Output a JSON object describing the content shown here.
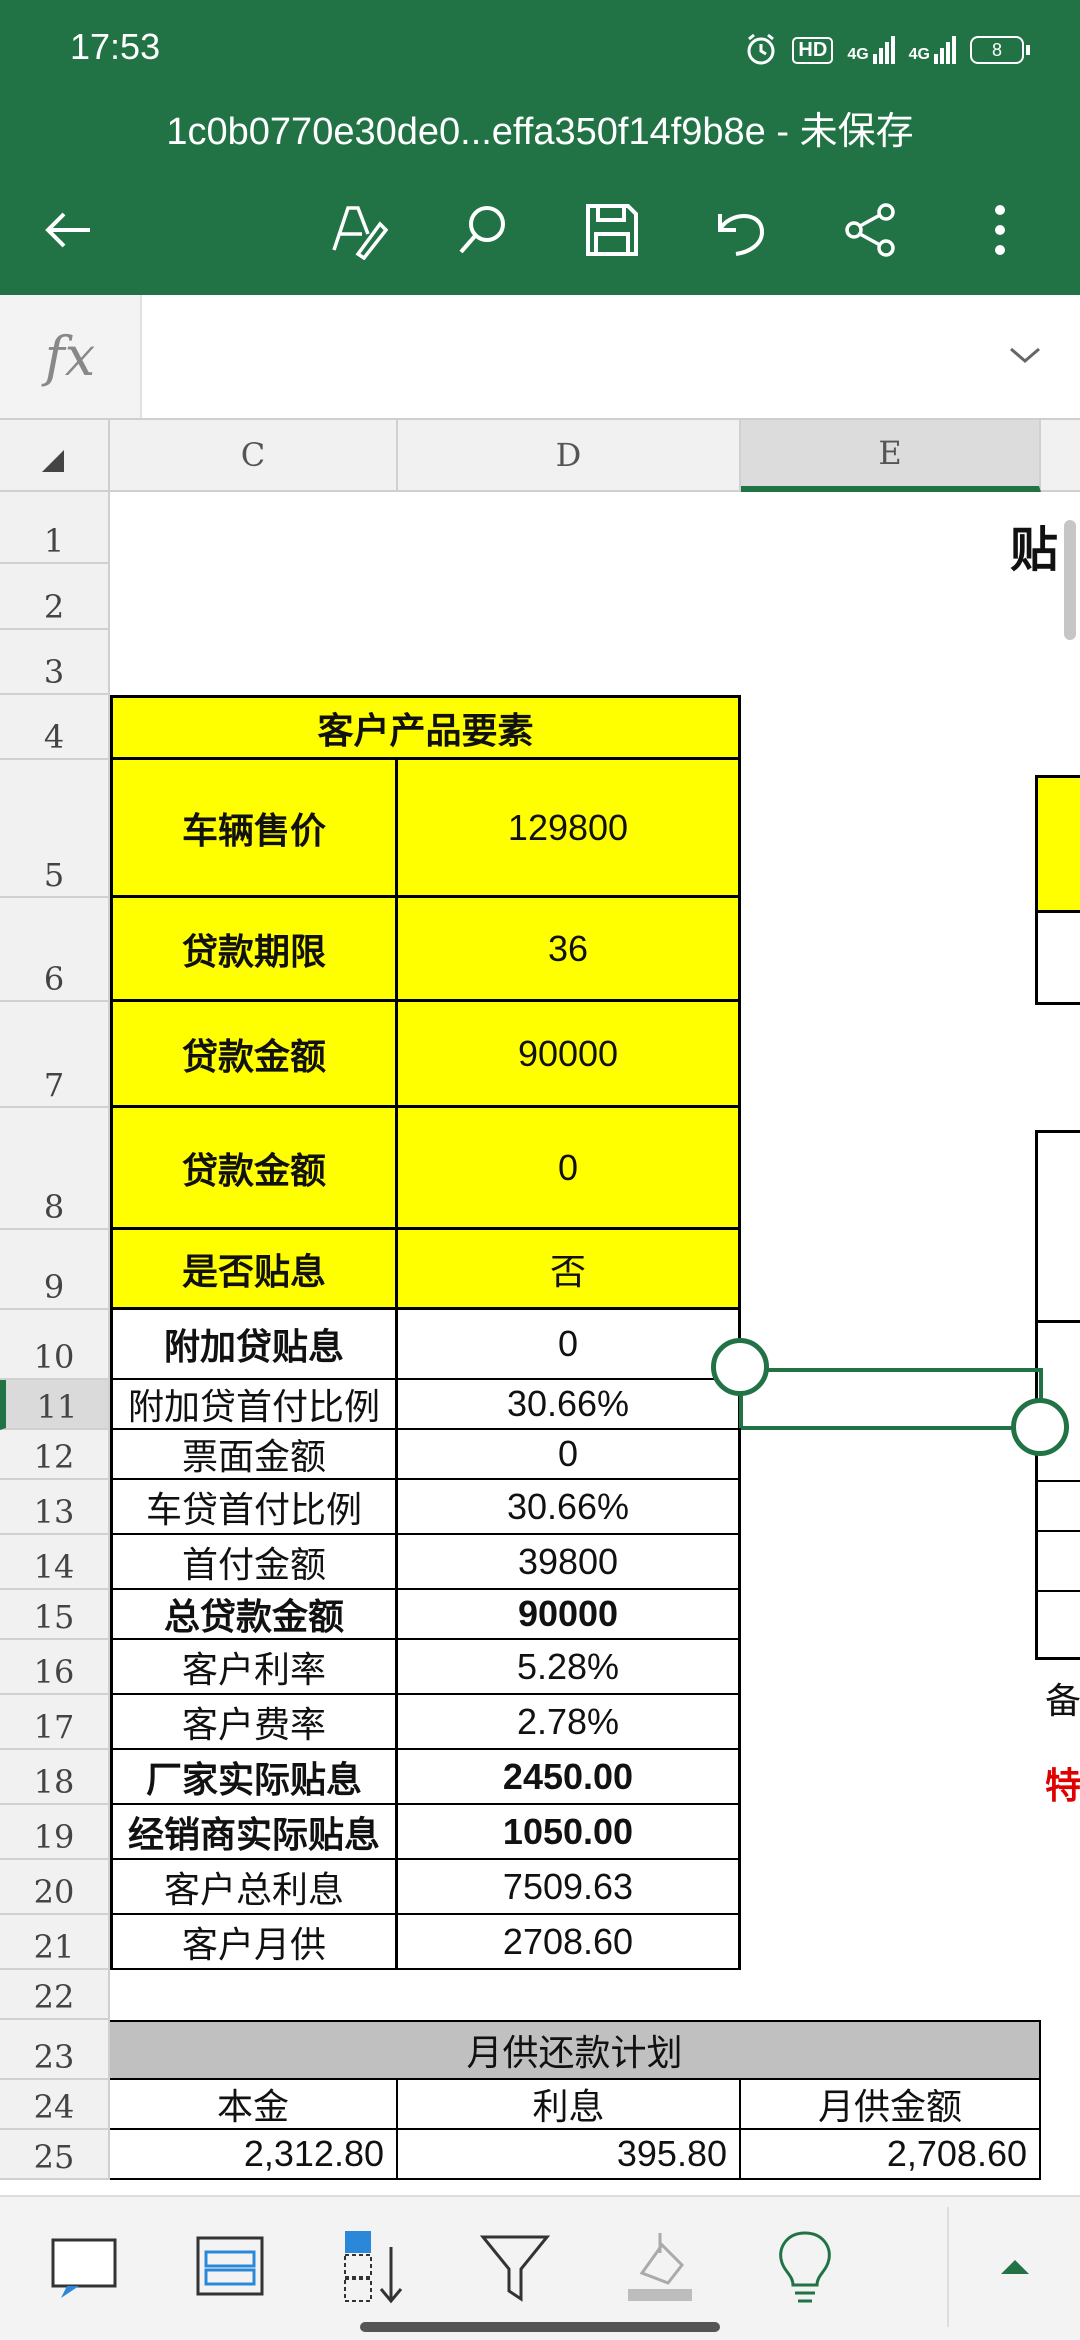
{
  "status_bar": {
    "time": "17:53",
    "hd_label": "HD",
    "network_1": "4G",
    "network_2": "4G",
    "battery": "8"
  },
  "title_bar": {
    "document_title": "1c0b0770e30de0...effa350f14f9b8e - 未保存"
  },
  "toolbar": {
    "icons": [
      "back-icon",
      "pen-icon",
      "search-icon",
      "save-icon",
      "undo-icon",
      "share-icon",
      "more-icon"
    ]
  },
  "formula_bar": {
    "fx_label": "fx",
    "value": ""
  },
  "columns": [
    "C",
    "D",
    "E"
  ],
  "rows": [
    "1",
    "2",
    "3",
    "4",
    "5",
    "6",
    "7",
    "8",
    "9",
    "10",
    "11",
    "12",
    "13",
    "14",
    "15",
    "16",
    "17",
    "18",
    "19",
    "20",
    "21",
    "22",
    "23",
    "24",
    "25"
  ],
  "sheet": {
    "right_title_fragment": "贴",
    "section_title": "客户产品要素",
    "items": [
      {
        "label": "车辆售价",
        "value": "129800"
      },
      {
        "label": "贷款期限",
        "value": "36"
      },
      {
        "label": "贷款金额",
        "value": "90000"
      },
      {
        "label": "贷款金额",
        "value": "0"
      },
      {
        "label": "是否贴息",
        "value": "否"
      },
      {
        "label": "附加贷贴息",
        "value": "0"
      },
      {
        "label": "附加贷首付比例",
        "value": "30.66%"
      },
      {
        "label": "票面金额",
        "value": "0"
      },
      {
        "label": "车贷首付比例",
        "value": "30.66%"
      },
      {
        "label": "首付金额",
        "value": "39800"
      },
      {
        "label": "总贷款金额",
        "value": "90000"
      },
      {
        "label": "客户利率",
        "value": "5.28%"
      },
      {
        "label": "客户费率",
        "value": "2.78%"
      },
      {
        "label": "厂家实际贴息",
        "value": "2450.00"
      },
      {
        "label": "经销商实际贴息",
        "value": "1050.00"
      },
      {
        "label": "客户总利息",
        "value": "7509.63"
      },
      {
        "label": "客户月供",
        "value": "2708.60"
      }
    ],
    "right_note_1": "备",
    "right_note_2": "特",
    "schedule": {
      "title": "月供还款计划",
      "headers": [
        "本金",
        "利息",
        "月供金额"
      ],
      "first_row": [
        "2,312.80",
        "395.80",
        "2,708.60"
      ]
    }
  },
  "colors": {
    "accent": "#217346",
    "highlight": "#ffff00",
    "note_red": "#e00000",
    "schedule_header": "#c0c0c0"
  },
  "bottom_toolbar": {
    "icons": [
      "comment-icon",
      "freeze-panes-icon",
      "sort-icon",
      "filter-icon",
      "fill-color-icon",
      "tell-me-icon",
      "expand-up-icon"
    ]
  }
}
